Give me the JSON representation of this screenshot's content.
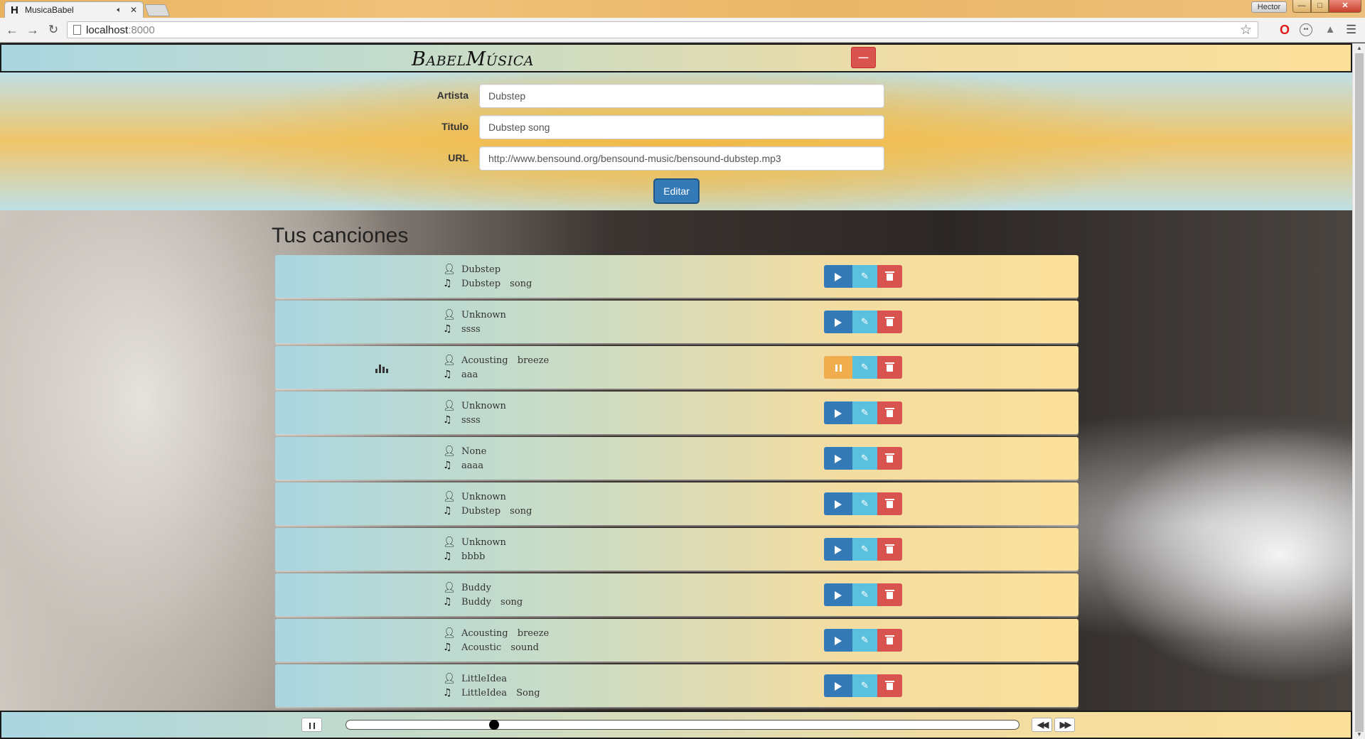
{
  "browser": {
    "tab_title": "MusicaBabel",
    "tab_favicon": "H",
    "profile_name": "Hector",
    "url_host": "localhost",
    "url_port": ":8000"
  },
  "app": {
    "brand": "BabelMúsica",
    "header_button_icon": "minus-icon"
  },
  "form": {
    "artist_label": "Artista",
    "artist_value": "Dubstep",
    "title_label": "Titulo",
    "title_value": "Dubstep song",
    "url_label": "URL",
    "url_value": "http://www.bensound.org/bensound-music/bensound-dubstep.mp3",
    "submit_label": "Editar"
  },
  "songs_section": {
    "title": "Tus canciones",
    "songs": [
      {
        "artist": "Dubstep",
        "title": "Dubstep song",
        "playing": false
      },
      {
        "artist": "Unknown",
        "title": "ssss",
        "playing": false
      },
      {
        "artist": "Acousting breeze",
        "title": "aaa",
        "playing": true
      },
      {
        "artist": "Unknown",
        "title": "ssss",
        "playing": false
      },
      {
        "artist": "None",
        "title": "aaaa",
        "playing": false
      },
      {
        "artist": "Unknown",
        "title": "Dubstep song",
        "playing": false
      },
      {
        "artist": "Unknown",
        "title": "bbbb",
        "playing": false
      },
      {
        "artist": "Buddy",
        "title": "Buddy song",
        "playing": false
      },
      {
        "artist": "Acousting breeze",
        "title": "Acoustic sound",
        "playing": false
      },
      {
        "artist": "LittleIdea",
        "title": "LittleIdea Song",
        "playing": false
      }
    ]
  },
  "player": {
    "progress_fraction": 0.22
  },
  "colors": {
    "primary": "#337ab7",
    "info": "#5bc0de",
    "danger": "#d9534f",
    "warning": "#f0ad4e"
  }
}
